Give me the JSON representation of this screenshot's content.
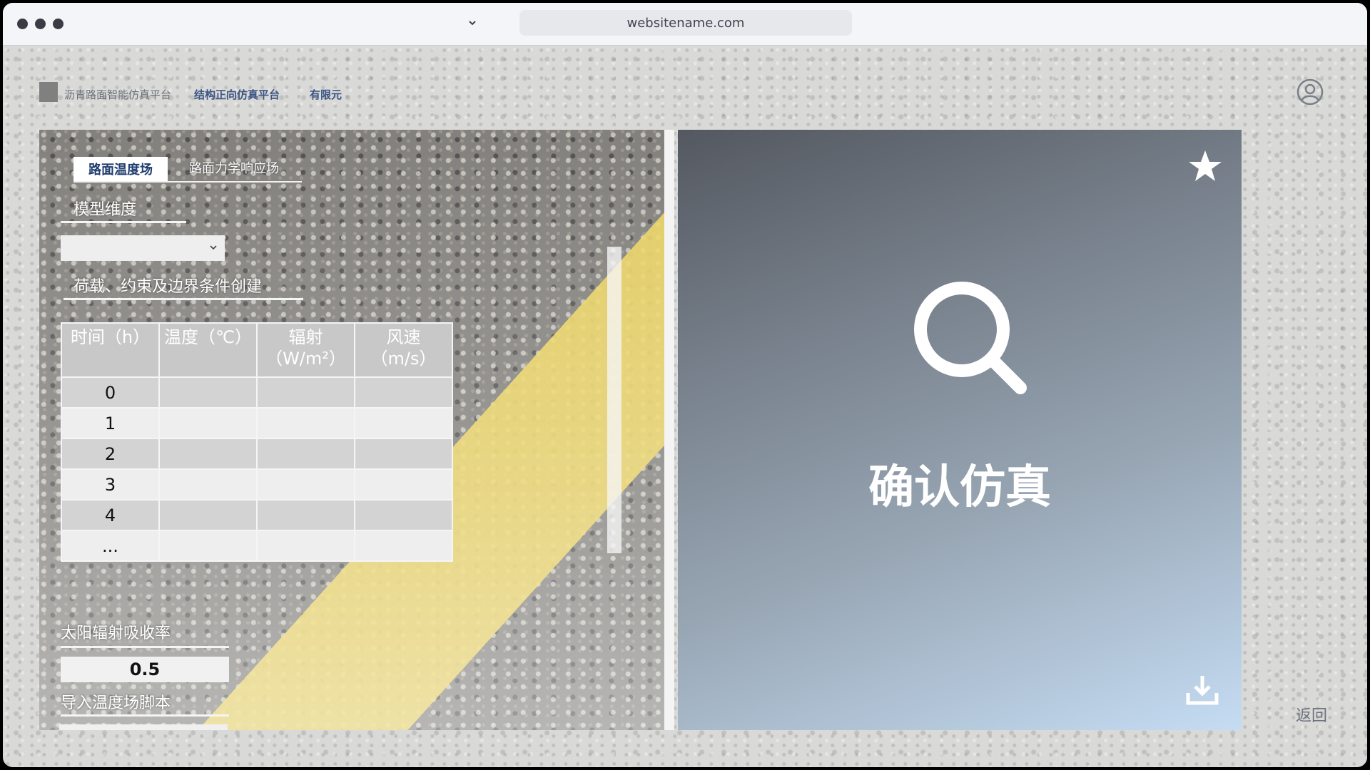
{
  "browser": {
    "url": "websitename.com"
  },
  "nav": {
    "brand": "沥青路面智能仿真平台",
    "items": [
      "结构正向仿真平台",
      "有限元"
    ]
  },
  "left_panel": {
    "tabs": [
      {
        "label": "路面温度场",
        "active": true
      },
      {
        "label": "路面力学响应场",
        "active": false
      }
    ],
    "model_dimension": {
      "label": "模型维度",
      "value": ""
    },
    "load_section": {
      "label": "荷载、约束及边界条件创建"
    },
    "table": {
      "headers": [
        [
          "时间（h）"
        ],
        [
          "温度（℃）"
        ],
        [
          "辐射",
          "（W/m²）"
        ],
        [
          "风速",
          "（m/s）"
        ]
      ],
      "rows": [
        [
          "0",
          "",
          "",
          ""
        ],
        [
          "1",
          "",
          "",
          ""
        ],
        [
          "2",
          "",
          "",
          ""
        ],
        [
          "3",
          "",
          "",
          ""
        ],
        [
          "4",
          "",
          "",
          ""
        ],
        [
          "...",
          "",
          "",
          ""
        ]
      ]
    },
    "solar_absorption": {
      "label": "太阳辐射吸收率",
      "value": "0.5"
    },
    "import_script": {
      "label": "导入温度场脚本",
      "value": ""
    }
  },
  "right_panel": {
    "title": "确认仿真"
  },
  "footer": {
    "back_label": "返回"
  },
  "colors": {
    "nav_link": "#3b5584",
    "active_tab_text": "#1f3d6e"
  }
}
